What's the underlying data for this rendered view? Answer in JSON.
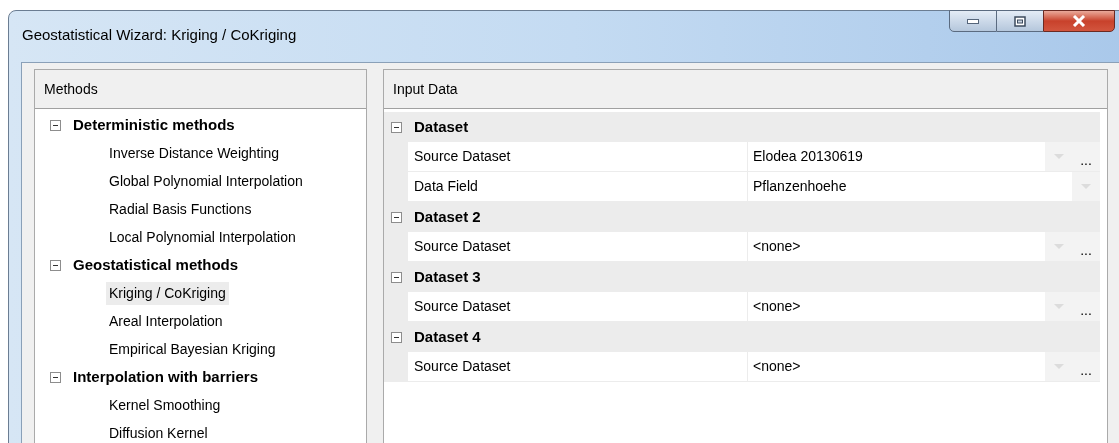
{
  "window": {
    "title": "Geostatistical Wizard: Kriging / CoKriging"
  },
  "methods": {
    "header": "Methods",
    "groups": [
      {
        "label": "Deterministic methods",
        "expanded": true,
        "children": [
          {
            "label": "Inverse Distance Weighting",
            "selected": false
          },
          {
            "label": "Global Polynomial Interpolation",
            "selected": false
          },
          {
            "label": "Radial Basis Functions",
            "selected": false
          },
          {
            "label": "Local Polynomial Interpolation",
            "selected": false
          }
        ]
      },
      {
        "label": "Geostatistical methods",
        "expanded": true,
        "children": [
          {
            "label": "Kriging / CoKriging",
            "selected": true
          },
          {
            "label": "Areal Interpolation",
            "selected": false
          },
          {
            "label": "Empirical Bayesian Kriging",
            "selected": false
          }
        ]
      },
      {
        "label": "Interpolation with barriers",
        "expanded": true,
        "children": [
          {
            "label": "Kernel Smoothing",
            "selected": false
          },
          {
            "label": "Diffusion Kernel",
            "selected": false
          }
        ]
      }
    ]
  },
  "input_data": {
    "header": "Input Data",
    "categories": [
      {
        "label": "Dataset",
        "expanded": true,
        "properties": [
          {
            "name": "Source Dataset",
            "value": "Elodea 20130619",
            "browse": "..."
          },
          {
            "name": "Data Field",
            "value": "Pflanzenhoehe"
          }
        ]
      },
      {
        "label": "Dataset 2",
        "expanded": true,
        "properties": [
          {
            "name": "Source Dataset",
            "value": "<none>",
            "browse": "..."
          }
        ]
      },
      {
        "label": "Dataset 3",
        "expanded": true,
        "properties": [
          {
            "name": "Source Dataset",
            "value": "<none>",
            "browse": "..."
          }
        ]
      },
      {
        "label": "Dataset 4",
        "expanded": true,
        "properties": [
          {
            "name": "Source Dataset",
            "value": "<none>",
            "browse": "..."
          }
        ]
      }
    ]
  }
}
